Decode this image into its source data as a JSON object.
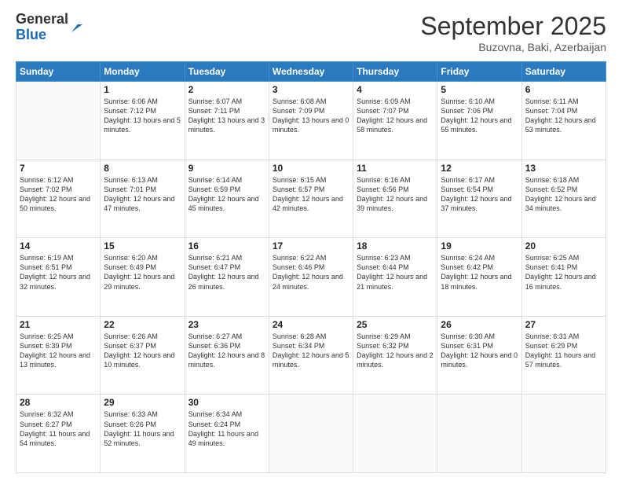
{
  "logo": {
    "general": "General",
    "blue": "Blue"
  },
  "header": {
    "month": "September 2025",
    "location": "Buzovna, Baki, Azerbaijan"
  },
  "weekdays": [
    "Sunday",
    "Monday",
    "Tuesday",
    "Wednesday",
    "Thursday",
    "Friday",
    "Saturday"
  ],
  "weeks": [
    [
      {
        "day": "",
        "sunrise": "",
        "sunset": "",
        "daylight": ""
      },
      {
        "day": "1",
        "sunrise": "Sunrise: 6:06 AM",
        "sunset": "Sunset: 7:12 PM",
        "daylight": "Daylight: 13 hours and 5 minutes."
      },
      {
        "day": "2",
        "sunrise": "Sunrise: 6:07 AM",
        "sunset": "Sunset: 7:11 PM",
        "daylight": "Daylight: 13 hours and 3 minutes."
      },
      {
        "day": "3",
        "sunrise": "Sunrise: 6:08 AM",
        "sunset": "Sunset: 7:09 PM",
        "daylight": "Daylight: 13 hours and 0 minutes."
      },
      {
        "day": "4",
        "sunrise": "Sunrise: 6:09 AM",
        "sunset": "Sunset: 7:07 PM",
        "daylight": "Daylight: 12 hours and 58 minutes."
      },
      {
        "day": "5",
        "sunrise": "Sunrise: 6:10 AM",
        "sunset": "Sunset: 7:06 PM",
        "daylight": "Daylight: 12 hours and 55 minutes."
      },
      {
        "day": "6",
        "sunrise": "Sunrise: 6:11 AM",
        "sunset": "Sunset: 7:04 PM",
        "daylight": "Daylight: 12 hours and 53 minutes."
      }
    ],
    [
      {
        "day": "7",
        "sunrise": "Sunrise: 6:12 AM",
        "sunset": "Sunset: 7:02 PM",
        "daylight": "Daylight: 12 hours and 50 minutes."
      },
      {
        "day": "8",
        "sunrise": "Sunrise: 6:13 AM",
        "sunset": "Sunset: 7:01 PM",
        "daylight": "Daylight: 12 hours and 47 minutes."
      },
      {
        "day": "9",
        "sunrise": "Sunrise: 6:14 AM",
        "sunset": "Sunset: 6:59 PM",
        "daylight": "Daylight: 12 hours and 45 minutes."
      },
      {
        "day": "10",
        "sunrise": "Sunrise: 6:15 AM",
        "sunset": "Sunset: 6:57 PM",
        "daylight": "Daylight: 12 hours and 42 minutes."
      },
      {
        "day": "11",
        "sunrise": "Sunrise: 6:16 AM",
        "sunset": "Sunset: 6:56 PM",
        "daylight": "Daylight: 12 hours and 39 minutes."
      },
      {
        "day": "12",
        "sunrise": "Sunrise: 6:17 AM",
        "sunset": "Sunset: 6:54 PM",
        "daylight": "Daylight: 12 hours and 37 minutes."
      },
      {
        "day": "13",
        "sunrise": "Sunrise: 6:18 AM",
        "sunset": "Sunset: 6:52 PM",
        "daylight": "Daylight: 12 hours and 34 minutes."
      }
    ],
    [
      {
        "day": "14",
        "sunrise": "Sunrise: 6:19 AM",
        "sunset": "Sunset: 6:51 PM",
        "daylight": "Daylight: 12 hours and 32 minutes."
      },
      {
        "day": "15",
        "sunrise": "Sunrise: 6:20 AM",
        "sunset": "Sunset: 6:49 PM",
        "daylight": "Daylight: 12 hours and 29 minutes."
      },
      {
        "day": "16",
        "sunrise": "Sunrise: 6:21 AM",
        "sunset": "Sunset: 6:47 PM",
        "daylight": "Daylight: 12 hours and 26 minutes."
      },
      {
        "day": "17",
        "sunrise": "Sunrise: 6:22 AM",
        "sunset": "Sunset: 6:46 PM",
        "daylight": "Daylight: 12 hours and 24 minutes."
      },
      {
        "day": "18",
        "sunrise": "Sunrise: 6:23 AM",
        "sunset": "Sunset: 6:44 PM",
        "daylight": "Daylight: 12 hours and 21 minutes."
      },
      {
        "day": "19",
        "sunrise": "Sunrise: 6:24 AM",
        "sunset": "Sunset: 6:42 PM",
        "daylight": "Daylight: 12 hours and 18 minutes."
      },
      {
        "day": "20",
        "sunrise": "Sunrise: 6:25 AM",
        "sunset": "Sunset: 6:41 PM",
        "daylight": "Daylight: 12 hours and 16 minutes."
      }
    ],
    [
      {
        "day": "21",
        "sunrise": "Sunrise: 6:25 AM",
        "sunset": "Sunset: 6:39 PM",
        "daylight": "Daylight: 12 hours and 13 minutes."
      },
      {
        "day": "22",
        "sunrise": "Sunrise: 6:26 AM",
        "sunset": "Sunset: 6:37 PM",
        "daylight": "Daylight: 12 hours and 10 minutes."
      },
      {
        "day": "23",
        "sunrise": "Sunrise: 6:27 AM",
        "sunset": "Sunset: 6:36 PM",
        "daylight": "Daylight: 12 hours and 8 minutes."
      },
      {
        "day": "24",
        "sunrise": "Sunrise: 6:28 AM",
        "sunset": "Sunset: 6:34 PM",
        "daylight": "Daylight: 12 hours and 5 minutes."
      },
      {
        "day": "25",
        "sunrise": "Sunrise: 6:29 AM",
        "sunset": "Sunset: 6:32 PM",
        "daylight": "Daylight: 12 hours and 2 minutes."
      },
      {
        "day": "26",
        "sunrise": "Sunrise: 6:30 AM",
        "sunset": "Sunset: 6:31 PM",
        "daylight": "Daylight: 12 hours and 0 minutes."
      },
      {
        "day": "27",
        "sunrise": "Sunrise: 6:31 AM",
        "sunset": "Sunset: 6:29 PM",
        "daylight": "Daylight: 11 hours and 57 minutes."
      }
    ],
    [
      {
        "day": "28",
        "sunrise": "Sunrise: 6:32 AM",
        "sunset": "Sunset: 6:27 PM",
        "daylight": "Daylight: 11 hours and 54 minutes."
      },
      {
        "day": "29",
        "sunrise": "Sunrise: 6:33 AM",
        "sunset": "Sunset: 6:26 PM",
        "daylight": "Daylight: 11 hours and 52 minutes."
      },
      {
        "day": "30",
        "sunrise": "Sunrise: 6:34 AM",
        "sunset": "Sunset: 6:24 PM",
        "daylight": "Daylight: 11 hours and 49 minutes."
      },
      {
        "day": "",
        "sunrise": "",
        "sunset": "",
        "daylight": ""
      },
      {
        "day": "",
        "sunrise": "",
        "sunset": "",
        "daylight": ""
      },
      {
        "day": "",
        "sunrise": "",
        "sunset": "",
        "daylight": ""
      },
      {
        "day": "",
        "sunrise": "",
        "sunset": "",
        "daylight": ""
      }
    ]
  ]
}
